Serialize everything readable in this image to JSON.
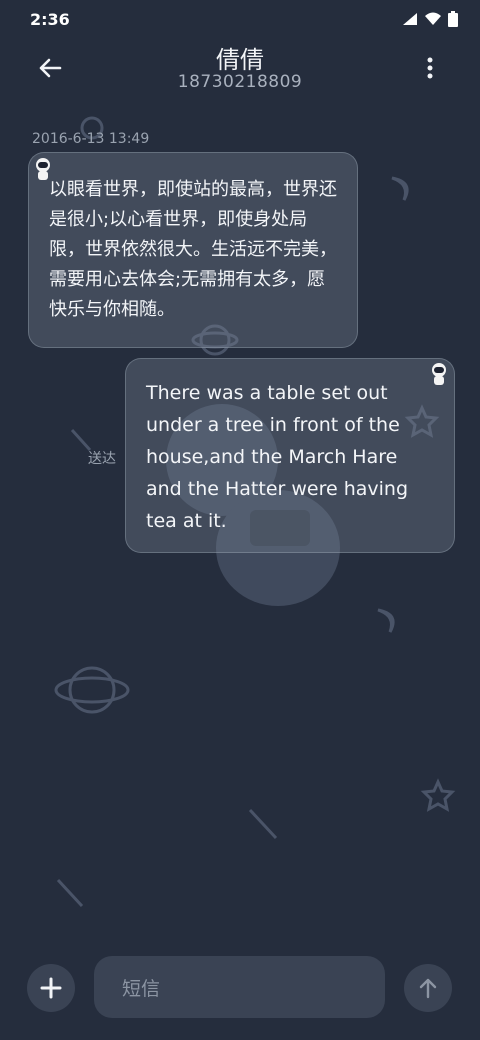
{
  "status_bar": {
    "time": "2:36"
  },
  "header": {
    "contact_name": "倩倩",
    "phone_number": "18730218809"
  },
  "conversation": {
    "timestamp": "2016-6-13 13:49",
    "incoming_message": "以眼看世界，即使站的最高，世界还是很小;以心看世界，即使身处局限，世界依然很大。生活远不完美，需要用心去体会;无需拥有太多，愿快乐与你相随。",
    "outgoing_message": "There was a table set out under a tree in front of the house,and the March Hare and the Hatter were having tea at it.",
    "delivery_status": "送达"
  },
  "composer": {
    "placeholder": "短信"
  },
  "colors": {
    "background": "#252d3d",
    "bubble": "#4a5566",
    "button": "#3a4354"
  },
  "icons": [
    "back-arrow-icon",
    "more-vert-icon",
    "plus-icon",
    "send-arrow-icon",
    "signal-icon",
    "wifi-icon",
    "battery-icon",
    "astronaut-icon"
  ]
}
